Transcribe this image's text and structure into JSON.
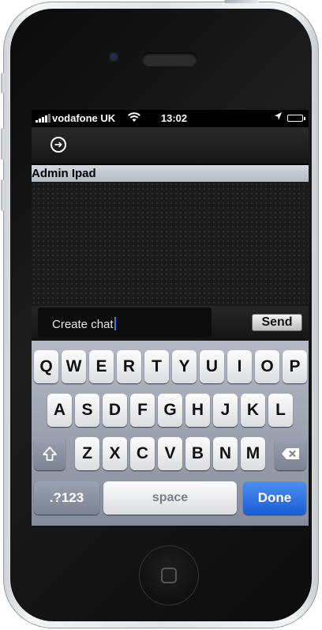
{
  "status_bar": {
    "carrier": "vodafone UK",
    "time": "13:02",
    "signal_icon": "signal-bars-icon",
    "wifi_icon": "wifi-icon",
    "location_icon": "location-arrow-icon",
    "battery_icon": "battery-icon"
  },
  "nav": {
    "action_icon": "arrow-circle-icon"
  },
  "chat_header": "Admin Ipad",
  "composer": {
    "input_value": "Create chat",
    "send_label": "Send"
  },
  "keyboard": {
    "row1": [
      "Q",
      "W",
      "E",
      "R",
      "T",
      "Y",
      "U",
      "I",
      "O",
      "P"
    ],
    "row2": [
      "A",
      "S",
      "D",
      "F",
      "G",
      "H",
      "J",
      "K",
      "L"
    ],
    "row3": [
      "Z",
      "X",
      "C",
      "V",
      "B",
      "N",
      "M"
    ],
    "numbers_label": ".?123",
    "space_label": "space",
    "done_label": "Done",
    "shift_icon": "shift-arrow-icon",
    "backspace_icon": "backspace-icon",
    "done_color": "#1a5ed8"
  },
  "device": {
    "home_icon": "home-button-icon"
  }
}
